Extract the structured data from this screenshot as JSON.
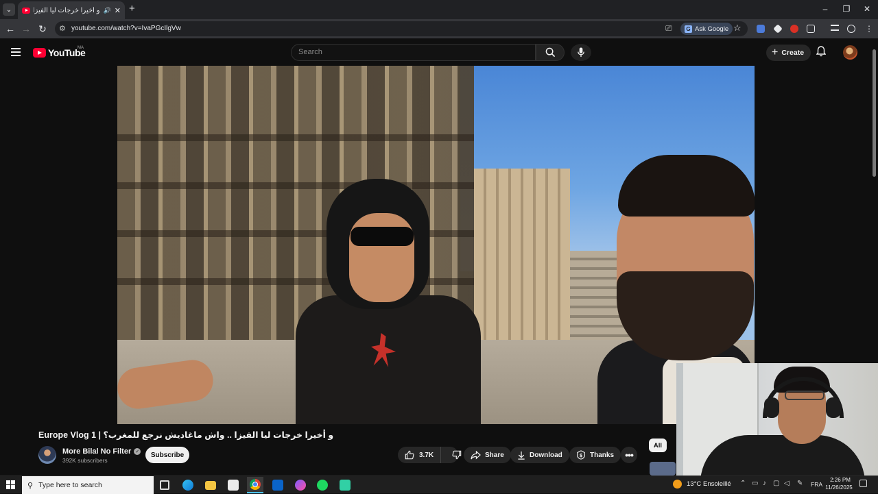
{
  "browser": {
    "tab_title": "و أخيرا خرجات ليا الفيزا .. واش",
    "address": "youtube.com/watch?v=IvaPGcIlgVw",
    "ask_google_label": "Ask Google"
  },
  "youtube": {
    "logo_text": "YouTube",
    "country_code": "MA",
    "search_placeholder": "Search",
    "create_label": "Create"
  },
  "video": {
    "title": "و أخيرا خرجات ليا الفيزا .. واش ماغاديش نرجع للمغرب؟ | Europe Vlog 1",
    "channel_name": "More Bilal No Filter",
    "subscribers": "392K subscribers",
    "subscribe_label": "Subscribe",
    "like_count": "3.7K",
    "share_label": "Share",
    "download_label": "Download",
    "thanks_label": "Thanks"
  },
  "sidebar": {
    "chip_all": "All"
  },
  "taskbar": {
    "search_placeholder": "Type here to search",
    "weather_temp": "13°C",
    "weather_desc": "Ensoleillé",
    "language": "FRA",
    "time": "2:26 PM",
    "date": "11/26/2025"
  },
  "colors": {
    "youtube_red": "#ff0033",
    "background": "#0f0f0f",
    "chrome_tabstrip": "#202124"
  }
}
